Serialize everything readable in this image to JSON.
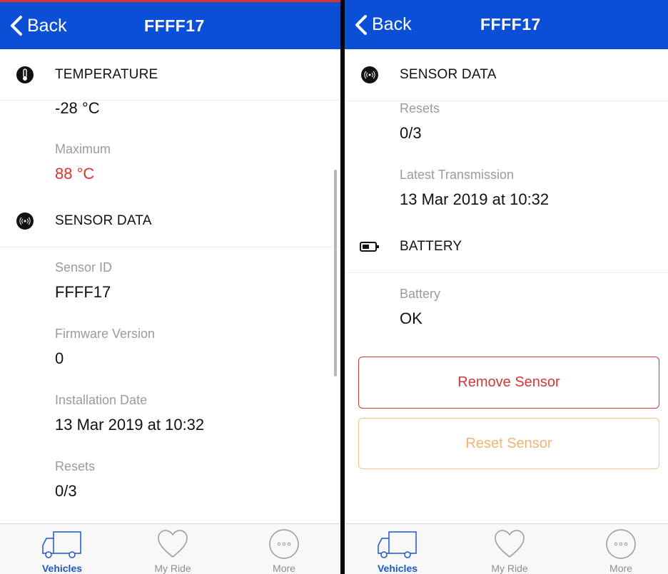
{
  "colors": {
    "nav_blue": "#0b4fd6",
    "alert_red": "#d9342b",
    "reset_orange": "#f2b375",
    "tab_active": "#1d57c8"
  },
  "left": {
    "nav": {
      "back_label": "Back",
      "title": "FFFF17"
    },
    "temperature": {
      "title": "TEMPERATURE",
      "min_value": "-28 °C",
      "max_label": "Maximum",
      "max_value": "88 °C"
    },
    "sensor": {
      "title": "SENSOR DATA",
      "fields": [
        {
          "label": "Sensor ID",
          "value": "FFFF17"
        },
        {
          "label": "Firmware Version",
          "value": "0"
        },
        {
          "label": "Installation Date",
          "value": "13 Mar 2019 at 10:32"
        },
        {
          "label": "Resets",
          "value": "0/3"
        }
      ]
    }
  },
  "right": {
    "nav": {
      "back_label": "Back",
      "title": "FFFF17"
    },
    "sensor": {
      "title": "SENSOR DATA",
      "fields": [
        {
          "label": "Resets",
          "value": "0/3"
        },
        {
          "label": "Latest Transmission",
          "value": "13 Mar 2019 at 10:32"
        }
      ]
    },
    "battery": {
      "title": "BATTERY",
      "label": "Battery",
      "value": "OK"
    },
    "buttons": {
      "remove": "Remove Sensor",
      "reset": "Reset Sensor"
    }
  },
  "tabbar": {
    "tabs": [
      {
        "label": "Vehicles",
        "icon": "truck-icon",
        "active": true
      },
      {
        "label": "My Ride",
        "icon": "heart-icon",
        "active": false
      },
      {
        "label": "More",
        "icon": "more-icon",
        "active": false
      }
    ]
  }
}
